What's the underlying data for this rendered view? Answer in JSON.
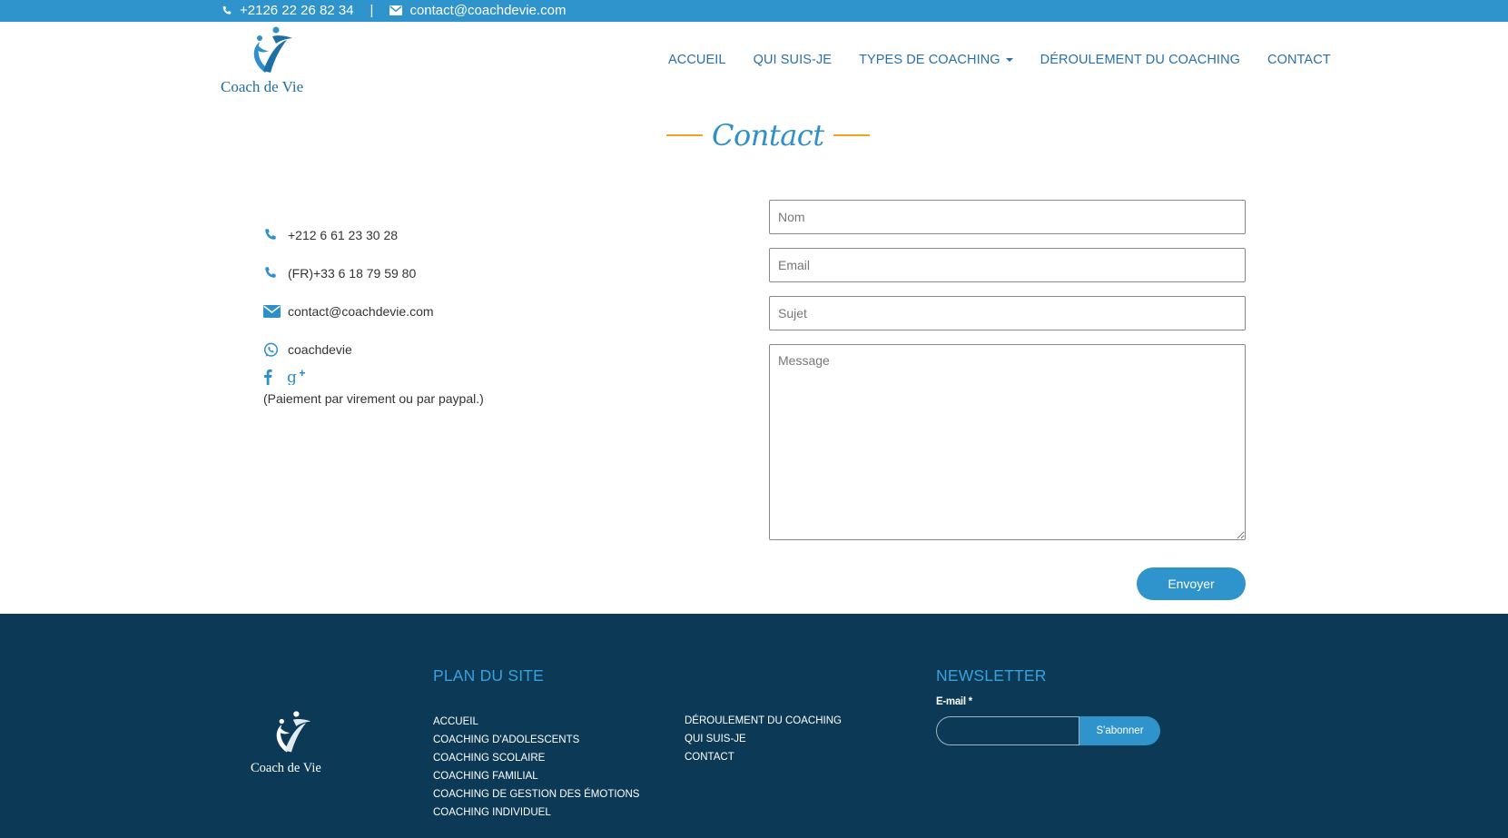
{
  "topbar": {
    "phone": "+2126 22 26 82 34",
    "separator": "|",
    "email": "contact@coachdevie.com"
  },
  "brand": {
    "name": "Coach de Vie"
  },
  "nav": {
    "items": [
      {
        "label": "ACCUEIL"
      },
      {
        "label": "QUI SUIS-JE"
      },
      {
        "label": "TYPES DE COACHING"
      },
      {
        "label": "DÉROULEMENT DU COACHING"
      },
      {
        "label": "CONTACT"
      }
    ]
  },
  "page": {
    "title": "Contact"
  },
  "contact_info": {
    "phone_ma": "+212 6 61 23 30 28",
    "phone_fr": "(FR)+33 6 18 79 59 80",
    "email": "contact@coachdevie.com",
    "whatsapp": "coachdevie",
    "payment_note": "(Paiement par virement ou par paypal.)"
  },
  "form": {
    "name_placeholder": "Nom",
    "email_placeholder": "Email",
    "subject_placeholder": "Sujet",
    "message_placeholder": "Message",
    "submit_label": "Envoyer"
  },
  "footer": {
    "sitemap_title": "PLAN DU SITE",
    "sitemap_col1": [
      "ACCUEIL",
      "COACHING D'ADOLESCENTS",
      "COACHING SCOLAIRE",
      "COACHING FAMILIAL",
      "COACHING DE GESTION DES ÉMOTIONS",
      "COACHING INDIVIDUEL"
    ],
    "sitemap_col2": [
      "DÉROULEMENT DU COACHING",
      "QUI SUIS-JE",
      "CONTACT"
    ],
    "newsletter_title": "NEWSLETTER",
    "newsletter_label": "E-mail",
    "newsletter_required": "*",
    "newsletter_button": "S'abonner"
  },
  "colors": {
    "accent": "#2f93cc",
    "footer_bg": "#0c3a56",
    "title_rule": "#f2a21b"
  }
}
